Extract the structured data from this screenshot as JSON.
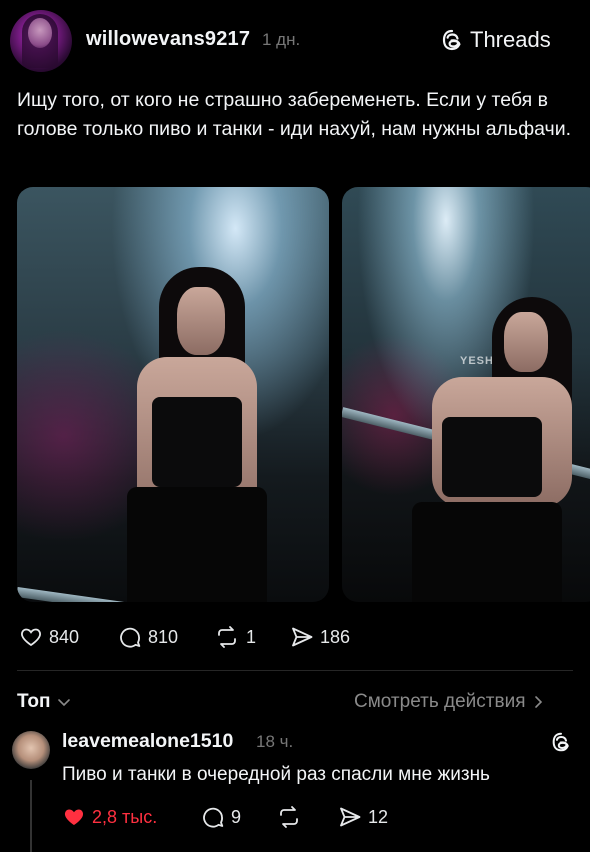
{
  "post": {
    "username": "willowevans9217",
    "time": "1 дн.",
    "brand": "Threads",
    "text": "Ищу того, от кого не страшно забеременеть. Если у тебя в голове только пиво и танки - иди нахуй, нам нужны альфачи.",
    "overlay_text": "YESH",
    "actions": {
      "likes": "840",
      "comments": "810",
      "reposts": "1",
      "shares": "186"
    }
  },
  "sort": {
    "label": "Топ",
    "view_activity": "Смотреть действия"
  },
  "reply": {
    "username": "leavemealone1510",
    "time": "18 ч.",
    "text": "Пиво и танки в очередной раз спасли мне жизнь",
    "actions": {
      "likes": "2,8 тыс.",
      "comments": "9",
      "shares": "12"
    }
  },
  "icons": [
    "heart-icon",
    "comment-icon",
    "repost-icon",
    "share-icon",
    "threads-logo-icon",
    "chevron-down-icon",
    "chevron-right-icon"
  ],
  "colors": {
    "background": "#000000",
    "text": "#f3f5f7",
    "muted": "#777777",
    "like_active": "#ff3040"
  }
}
